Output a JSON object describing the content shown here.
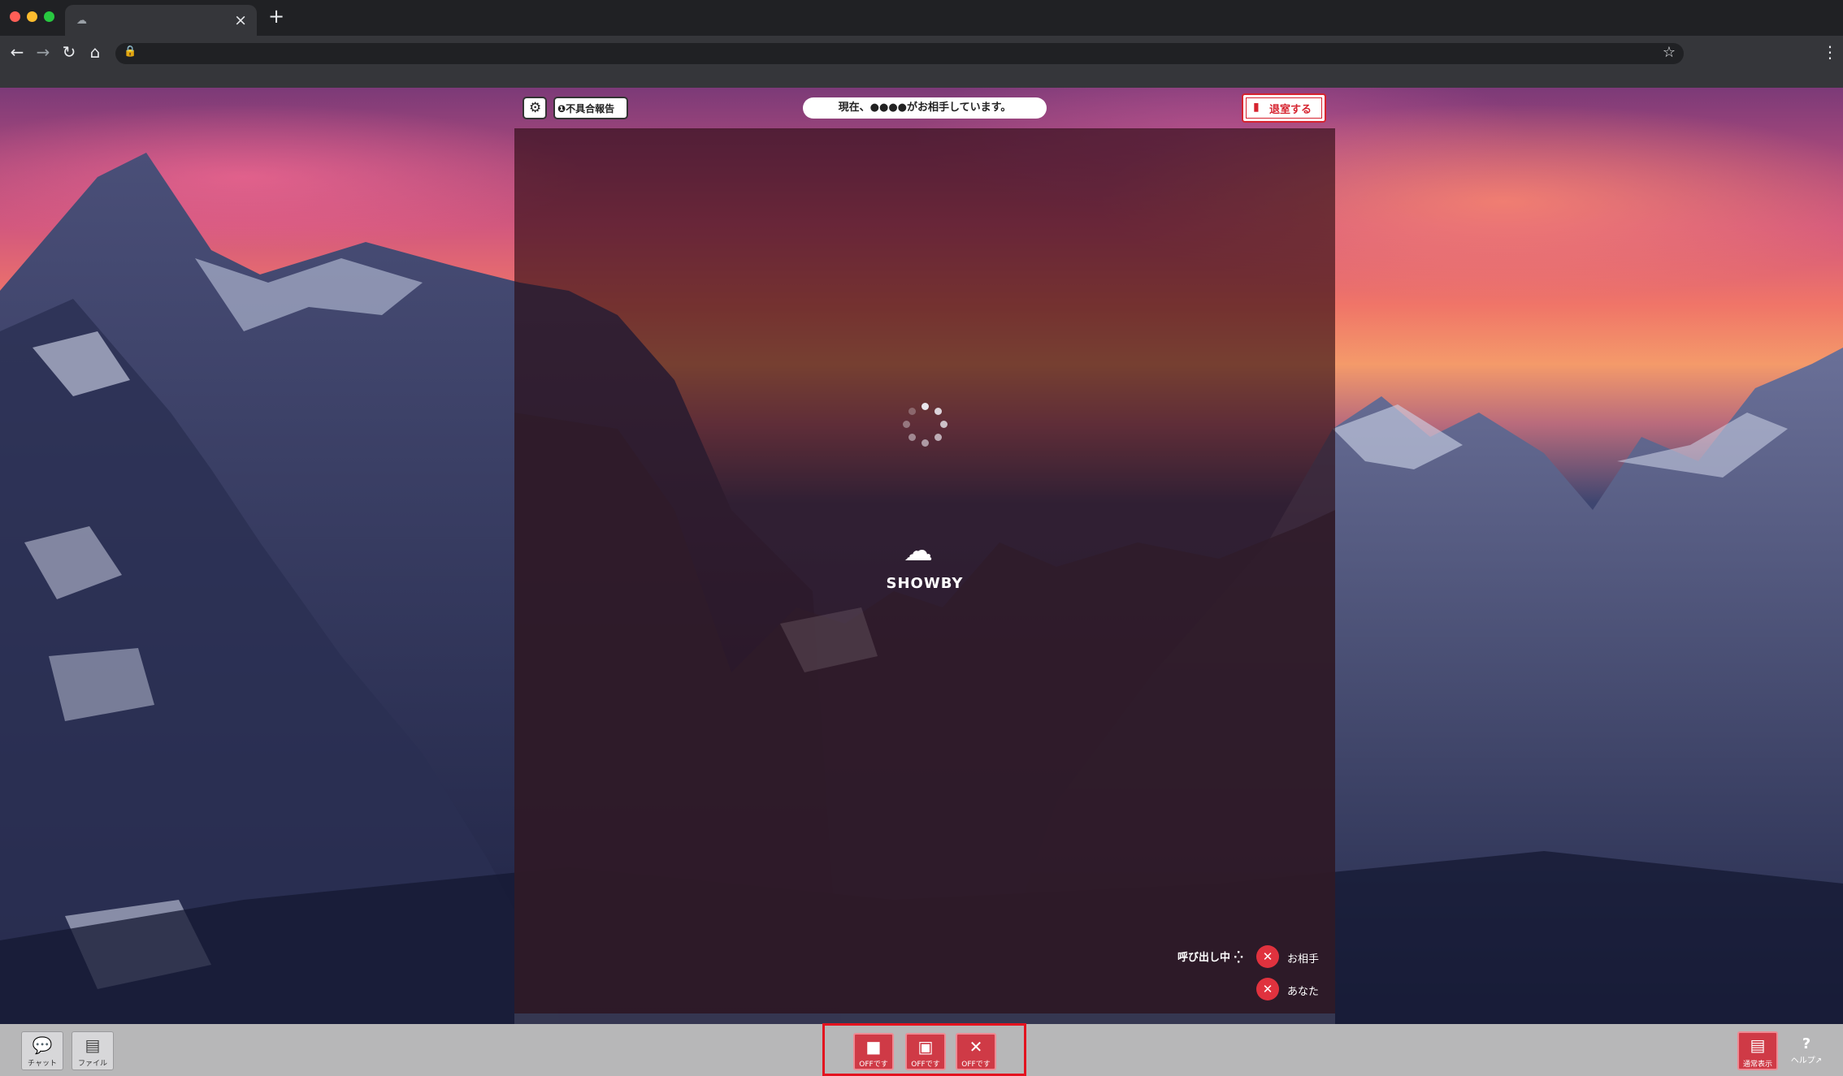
{
  "browser": {
    "tab_icon": "cloud-icon",
    "close_glyph": "×",
    "newtab_glyph": "+",
    "back_glyph": "←",
    "forward_glyph": "→",
    "reload_glyph": "↻",
    "home_glyph": "⌂",
    "lock_glyph": "🔒",
    "star_glyph": "☆",
    "menu_glyph": "⋮"
  },
  "header": {
    "settings_icon": "⚙",
    "report_label": "❶不具合報告",
    "status_text": "現在、●●●●がお相手しています。",
    "leave_label": "退室する",
    "leave_icon": "▮"
  },
  "main": {
    "brand_icon": "☁",
    "brand_name": "SHOWBY",
    "calling_text": "呼び出し中 ⁛",
    "partner_label": "お相手",
    "you_label": "あなた",
    "mic_off_icon": "✕"
  },
  "bottom": {
    "chat_icon": "💬",
    "chat_label": "チャット",
    "file_icon": "▤",
    "file_label": "ファイル",
    "media_buttons": [
      {
        "icon": "■",
        "label": "OFFです"
      },
      {
        "icon": "▣",
        "label": "OFFです"
      },
      {
        "icon": "✕",
        "label": "OFFです"
      }
    ],
    "normal_icon": "▤",
    "normal_label": "通常表示",
    "help_icon": "?",
    "help_label": "ヘルプ↗"
  },
  "colors": {
    "accent_red": "#d6232f",
    "highlight_box": "#e3131f",
    "mute_red": "#e0323e"
  }
}
